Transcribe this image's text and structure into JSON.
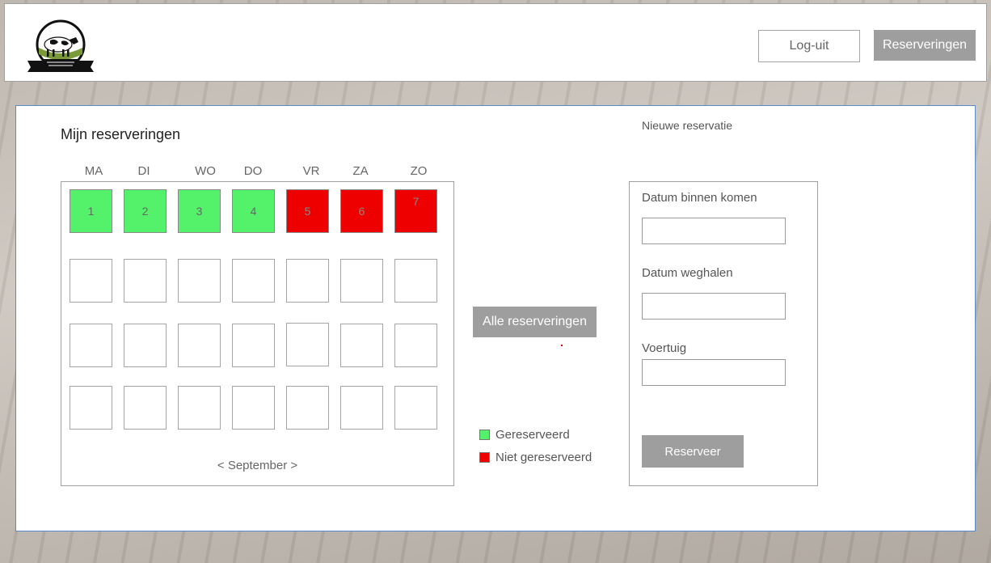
{
  "header": {
    "logo_text": "Ter Stal camper- en caravanstalling",
    "logout_label": "Log-uit",
    "reservations_label": "Reserveringen"
  },
  "calendar": {
    "title": "Mijn reserveringen",
    "days": [
      "MA",
      "DI",
      "WO",
      "DO",
      "VR",
      "ZA",
      "ZO"
    ],
    "first_week": [
      {
        "label": "1",
        "status": "gereserveerd"
      },
      {
        "label": "2",
        "status": "gereserveerd"
      },
      {
        "label": "3",
        "status": "gereserveerd"
      },
      {
        "label": "4",
        "status": "gereserveerd"
      },
      {
        "label": "5",
        "status": "niet gereserveerd"
      },
      {
        "label": "6",
        "status": "niet gereserveerd"
      },
      {
        "label": "7",
        "status": "niet gereserveerd"
      }
    ],
    "month_prev": "<",
    "month_label": "September",
    "month_next": ">"
  },
  "all_reservations_label": "Alle reserveringen",
  "legend": {
    "reserved": {
      "label": "Gereserveerd",
      "color": "#54f26b"
    },
    "not_reserved": {
      "label": "Niet gereserveerd",
      "color": "#ee0000"
    }
  },
  "form": {
    "title": "Nieuwe reservatie",
    "date_in_label": "Datum binnen komen",
    "date_in_value": "",
    "date_out_label": "Datum weghalen",
    "date_out_value": "",
    "vehicle_label": "Voertuig",
    "vehicle_value": "",
    "submit_label": "Reserveer"
  },
  "colors": {
    "button_gray": "#9e9e9e",
    "panel_border": "#5a8ac9"
  }
}
